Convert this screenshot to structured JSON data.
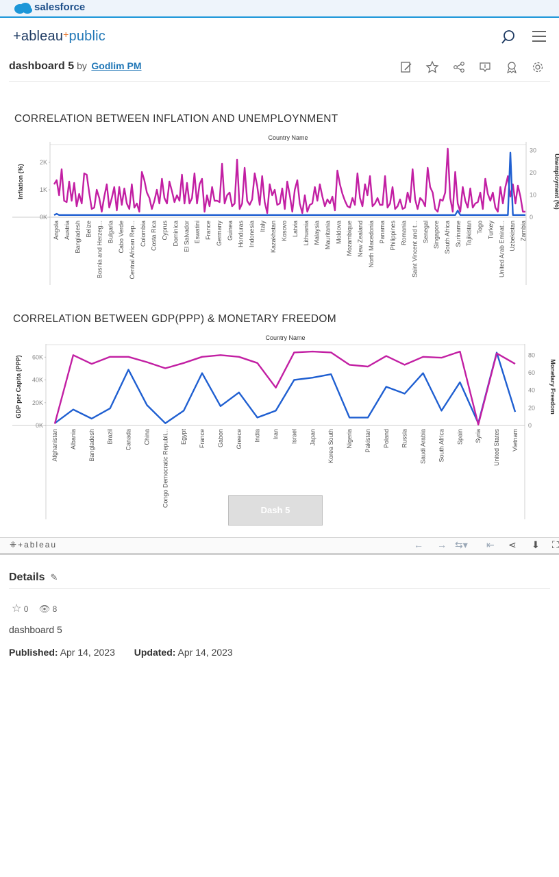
{
  "salesforce_brand": "salesforce",
  "logo": {
    "part1": "+ableau",
    "plus": "+",
    "part2": "public"
  },
  "dashboard": {
    "title": "dashboard 5",
    "by": "by",
    "author": "Godlim PM"
  },
  "chart1": {
    "title": "CORRELATION BETWEEN INFLATION AND UNEMPLOYNMENT",
    "header": "Country Name",
    "left_axis_label": "Inflation (%)",
    "right_axis_label": "Unemployment (%)",
    "left_ticks": [
      "2K",
      "1K",
      "0K"
    ],
    "right_ticks": [
      "30",
      "20",
      "10",
      "0"
    ]
  },
  "chart2": {
    "title": "CORRELATION BETWEEN GDP(PPP) & MONETARY FREEDOM",
    "header": "Country Name",
    "left_axis_label": "GDP per Capita (PPP)",
    "right_axis_label": "Monetary Freedom",
    "left_ticks": [
      "60K",
      "40K",
      "20K",
      "0K"
    ],
    "right_ticks": [
      "80",
      "60",
      "40",
      "20",
      "0"
    ]
  },
  "chart_data": [
    {
      "type": "line",
      "title": "CORRELATION BETWEEN INFLATION AND UNEMPLOYNMENT",
      "xlabel": "Country Name",
      "ylabel": "Inflation (%)",
      "y2label": "Unemployment (%)",
      "ylim": [
        0,
        2600
      ],
      "y2lim": [
        0,
        32
      ],
      "categories": [
        "Angola",
        "Austria",
        "Bangladesh",
        "Belize",
        "Bosnia and Herzeg...",
        "Bulgaria",
        "Cabo Verde",
        "Central African Rep...",
        "Colombia",
        "Costa Rica",
        "Cyprus",
        "Dominica",
        "El Salvador",
        "Eswatini",
        "France",
        "Germany",
        "Guinea",
        "Honduras",
        "Indonesia",
        "Italy",
        "Kazakhstan",
        "Kosovo",
        "Latvia",
        "Lithuania",
        "Malaysia",
        "Mauritania",
        "Moldova",
        "Mozambique",
        "New Zealand",
        "North Macedonia",
        "Panama",
        "Philippines",
        "Romania",
        "Saint Vincent and t...",
        "Senegal",
        "Singapore",
        "South Africa",
        "Suriname",
        "Tajikistan",
        "Togo",
        "Turkey",
        "United Arab Emirat...",
        "Uzbekistan",
        "Zambia"
      ],
      "series": [
        {
          "name": "Inflation (%)",
          "color": "#c21fa3",
          "values": [
            1200,
            1350,
            800,
            1750,
            600,
            550,
            1300,
            600,
            1250,
            400,
            850,
            500,
            1600,
            1550,
            900,
            300,
            350,
            1000,
            700,
            200,
            750,
            1200,
            350,
            700,
            1100,
            250,
            1100,
            450,
            1050,
            500,
            300,
            1200,
            350,
            500,
            200,
            1650,
            1350,
            900,
            700,
            300,
            600,
            1000,
            500,
            1400,
            700,
            500,
            1300,
            950,
            550,
            800,
            600,
            1550,
            500,
            1250,
            500,
            700,
            1600,
            500,
            1200,
            1400,
            200,
            800,
            400,
            1100,
            600,
            600,
            550,
            1950,
            500,
            800,
            900,
            400,
            500,
            2100,
            300,
            500,
            1800,
            600,
            450,
            650,
            1600,
            1150,
            450,
            1500,
            550,
            150,
            1200,
            800,
            1000,
            450,
            500,
            1050,
            300,
            1300,
            800,
            200,
            1000,
            1350,
            500,
            150,
            800,
            200,
            450,
            500,
            1100,
            600,
            1200,
            750,
            400,
            650,
            500,
            750,
            250,
            1700,
            1200,
            850,
            600,
            400,
            350,
            700,
            450,
            1600,
            700,
            400,
            1200,
            800,
            1500,
            400,
            500,
            700,
            450,
            450,
            1500,
            350,
            500,
            1100,
            300,
            400,
            650,
            300,
            350,
            900,
            550,
            1750,
            650,
            300,
            700,
            600,
            400,
            1800,
            1100,
            900,
            300,
            200,
            650,
            600,
            900,
            2500,
            700,
            200,
            1650,
            500,
            200,
            1100,
            600,
            350,
            1050,
            350,
            500,
            550,
            900,
            300,
            1400,
            850,
            600,
            900,
            350,
            200,
            1100,
            500,
            1100,
            1500,
            750,
            1200,
            500,
            1150,
            750,
            200,
            200
          ],
          "source": "Inflation (%)"
        },
        {
          "name": "Unemployment (%)",
          "color": "#1f5fd1",
          "values": [
            1,
            1.5,
            1,
            1,
            1,
            1,
            1,
            1,
            1,
            1,
            1,
            1,
            1,
            1,
            1,
            1,
            1,
            1,
            1,
            1,
            1,
            1,
            1,
            1,
            1,
            1,
            1,
            1,
            1,
            1,
            1,
            1,
            1,
            1,
            1,
            1,
            1,
            1,
            1,
            1,
            1,
            1,
            1,
            1,
            1,
            1,
            1,
            1,
            1,
            1,
            1,
            1,
            1,
            1,
            1,
            1,
            1,
            1,
            1,
            1,
            1,
            1,
            1,
            1,
            1,
            1,
            1,
            1,
            1,
            1,
            1,
            1,
            1,
            1,
            1,
            1,
            1,
            1,
            1,
            1,
            1,
            1,
            1,
            1,
            1,
            1,
            1,
            1,
            1,
            1,
            1,
            1,
            1,
            1,
            1,
            1,
            1,
            1,
            1,
            1,
            1,
            1,
            1,
            1,
            1,
            1,
            1,
            1,
            1,
            1,
            1,
            1,
            1,
            1,
            1,
            1,
            1,
            1,
            1,
            1,
            1,
            1,
            1,
            1,
            1,
            1,
            1,
            1,
            1,
            1,
            1,
            1,
            1,
            1,
            1,
            1,
            1,
            1,
            1,
            1,
            1,
            1,
            1,
            1,
            1,
            1,
            1,
            1,
            1,
            1,
            1,
            1,
            1,
            1,
            1,
            1,
            1,
            1,
            1,
            1,
            1,
            3,
            1,
            1,
            1,
            1,
            1,
            1,
            1,
            1,
            1,
            1,
            1,
            1,
            1,
            1,
            1,
            1,
            1,
            1,
            1,
            1,
            29,
            1,
            1,
            1,
            1,
            1,
            1
          ]
        }
      ]
    },
    {
      "type": "line",
      "title": "CORRELATION BETWEEN GDP(PPP) & MONETARY FREEDOM",
      "xlabel": "Country Name",
      "ylabel": "GDP per Capita (PPP)",
      "y2label": "Monetary Freedom",
      "ylim": [
        0,
        68000
      ],
      "y2lim": [
        0,
        88
      ],
      "categories": [
        "Afghanistan",
        "Albania",
        "Bangladesh",
        "Brazil",
        "Canada",
        "China",
        "Congo Democratic Republi...",
        "Egypt",
        "France",
        "Gabon",
        "Greece",
        "India",
        "Iran",
        "Israel",
        "Japan",
        "Korea South",
        "Nigeria",
        "Pakistan",
        "Poland",
        "Russia",
        "Saudi Arabia",
        "South Africa",
        "Spain",
        "Syria",
        "United States",
        "Vietnam"
      ],
      "series": [
        {
          "name": "GDP per Capita (PPP)",
          "color": "#1f5fd1",
          "values": [
            2000,
            14000,
            6000,
            15000,
            49000,
            18000,
            2000,
            13000,
            46000,
            17000,
            29000,
            7000,
            13000,
            40000,
            42000,
            45000,
            7000,
            7000,
            34000,
            28000,
            46000,
            13000,
            38000,
            2000,
            64000,
            12000
          ]
        },
        {
          "name": "Monetary Freedom",
          "color": "#c21fa3",
          "values": [
            2,
            80,
            70,
            78,
            78,
            72,
            65,
            71,
            78,
            80,
            78,
            71,
            43,
            83,
            84,
            83,
            69,
            67,
            79,
            69,
            78,
            77,
            84,
            1,
            82,
            70
          ]
        }
      ]
    }
  ]
}
